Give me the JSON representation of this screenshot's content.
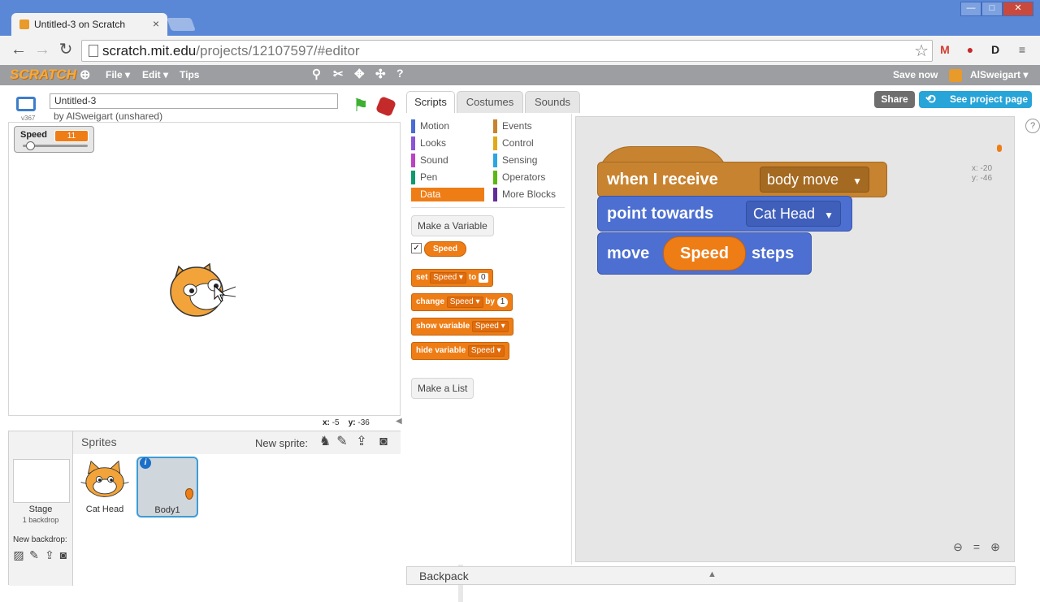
{
  "browser": {
    "tab_title": "Untitled-3 on Scratch",
    "url_host": "scratch.mit.edu",
    "url_path": "/projects/12107597/#editor",
    "window_buttons": [
      "—",
      "□",
      "✕"
    ]
  },
  "menubar": {
    "logo": "SCRATCH",
    "file": "File ▾",
    "edit": "Edit ▾",
    "tips": "Tips",
    "save": "Save now",
    "user": "AlSweigart ▾"
  },
  "stage": {
    "version": "v367",
    "title": "Untitled-3",
    "author": "by AlSweigart (unshared)",
    "monitor_label": "Speed",
    "monitor_value": "11",
    "monitor_level": 0.1,
    "x_label": "x:",
    "x_value": "-5",
    "y_label": "y:",
    "y_value": "-36"
  },
  "sprites": {
    "header": "Sprites",
    "new_sprite": "New sprite:",
    "stage_name": "Stage",
    "backdrops": "1 backdrop",
    "new_backdrop": "New backdrop:",
    "items": [
      {
        "name": "Cat Head"
      },
      {
        "name": "Body1"
      }
    ]
  },
  "tabs": {
    "scripts": "Scripts",
    "costumes": "Costumes",
    "sounds": "Sounds"
  },
  "buttons": {
    "share": "Share",
    "project_page": "See project page"
  },
  "categories": {
    "left": [
      {
        "label": "Motion",
        "color": "#4a6cd4"
      },
      {
        "label": "Looks",
        "color": "#8a55d7"
      },
      {
        "label": "Sound",
        "color": "#bb42c3"
      },
      {
        "label": "Pen",
        "color": "#0e9a6c"
      },
      {
        "label": "Data",
        "color": "#ee7d16"
      }
    ],
    "right": [
      {
        "label": "Events",
        "color": "#c88330"
      },
      {
        "label": "Control",
        "color": "#e1a91a"
      },
      {
        "label": "Sensing",
        "color": "#2ca5e2"
      },
      {
        "label": "Operators",
        "color": "#5cb712"
      },
      {
        "label": "More Blocks",
        "color": "#632d99"
      }
    ]
  },
  "palette": {
    "make_variable": "Make a Variable",
    "variable": "Speed",
    "set_kw": "set",
    "set_var": "Speed ▾",
    "set_to": "to",
    "set_val": "0",
    "change_kw": "change",
    "change_var": "Speed ▾",
    "change_by": "by",
    "change_val": "1",
    "show_kw": "show variable",
    "show_var": "Speed ▾",
    "hide_kw": "hide variable",
    "hide_var": "Speed ▾",
    "make_list": "Make a List"
  },
  "script": {
    "hat_text": "when I receive",
    "hat_msg": "body move",
    "point_text": "point towards",
    "point_target": "Cat Head",
    "move_text": "move",
    "move_var": "Speed",
    "move_suffix": "steps",
    "x_label": "x: -20",
    "y_label": "y: -46"
  },
  "backpack": {
    "label": "Backpack"
  },
  "colors": {
    "browser_frame": "#5a88d6",
    "menubar": "#9c9ea1",
    "data": "#ee7d16",
    "events": "#c88330",
    "motion": "#4c6fd1",
    "selected_sprite": "#3d9cd6"
  }
}
